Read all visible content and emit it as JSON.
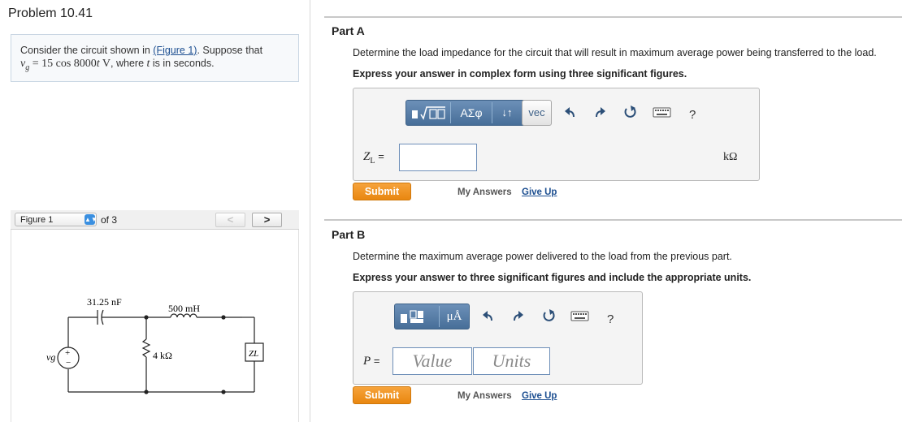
{
  "problem": {
    "title": "Problem 10.41",
    "intro_text": "Consider the circuit shown in",
    "figure_link": "(Figure 1)",
    "intro_suffix": ". Suppose that",
    "vg_sym": "v",
    "vg_sub": "g",
    "vg_eq": " = 15 cos 8000",
    "vg_t": "t",
    "vg_unit": " V",
    "intro_tail": ", where",
    "intro_t": "t",
    "intro_end": " is in seconds."
  },
  "figure": {
    "selector_label": "Figure 1",
    "of_label": "of 3",
    "prev_label": "<",
    "next_label": ">",
    "capacitor_label": "31.25 nF",
    "inductor_label": "500 mH",
    "resistor_label": "4 kΩ",
    "source_label": "vg",
    "load_label": "ZL",
    "plus": "+",
    "minus": "−"
  },
  "part_a": {
    "title": "Part A",
    "question": "Determine the load impedance for the circuit that will result in maximum average power being transferred to the load.",
    "instruction": "Express your answer in complex form using three significant figures.",
    "toolbar": {
      "greek_label": "ΑΣφ",
      "sort_label": "↓↑",
      "vec_label": "vec",
      "help_label": "?"
    },
    "answer_label": "Z",
    "answer_sub": "L",
    "equals": "=",
    "value": "",
    "unit": "kΩ",
    "submit_label": "Submit",
    "my_answers_label": "My Answers",
    "give_up_label": "Give Up"
  },
  "part_b": {
    "title": "Part B",
    "question": "Determine the maximum average power delivered to the load from the previous part.",
    "instruction": "Express your answer to three significant figures and include the appropriate units.",
    "toolbar": {
      "units_label": "μÅ",
      "help_label": "?"
    },
    "answer_label": "P",
    "equals": "=",
    "value_placeholder": "Value",
    "units_placeholder": "Units",
    "submit_label": "Submit",
    "my_answers_label": "My Answers",
    "give_up_label": "Give Up"
  },
  "colors": {
    "accent_blue": "#4f77a3",
    "submit_orange": "#ef9420",
    "link_blue": "#1d4f91"
  }
}
